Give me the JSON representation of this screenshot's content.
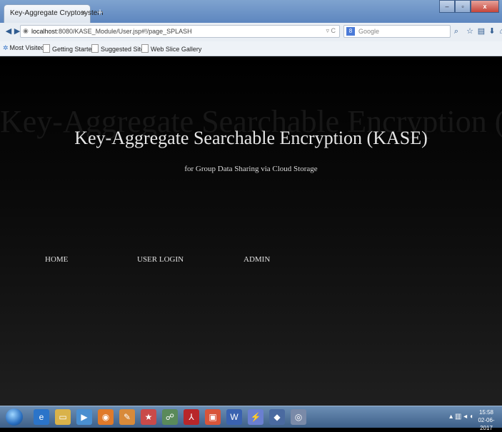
{
  "browser": {
    "tab_title": "Key-Aggregate Cryptosystem",
    "tab_close": "×",
    "new_tab": "+",
    "url_host": "localhost",
    "url_rest": ":8080/KASE_Module/User.jsp#!/page_SPLASH",
    "search_placeholder": "Google",
    "bookmarks": [
      "Most Visited",
      "Getting Started",
      "Suggested Sites",
      "Web Slice Gallery"
    ]
  },
  "page": {
    "ghost_title": "Key-Aggregate Searchable Encryption (KASE)",
    "title": "Key-Aggregate Searchable Encryption (KASE)",
    "subtitle": "for Group Data Sharing via Cloud Storage",
    "nav": [
      "HOME",
      "USER LOGIN",
      "ADMIN"
    ]
  },
  "taskbar": {
    "time": "15:58",
    "date": "02-06-2017"
  }
}
